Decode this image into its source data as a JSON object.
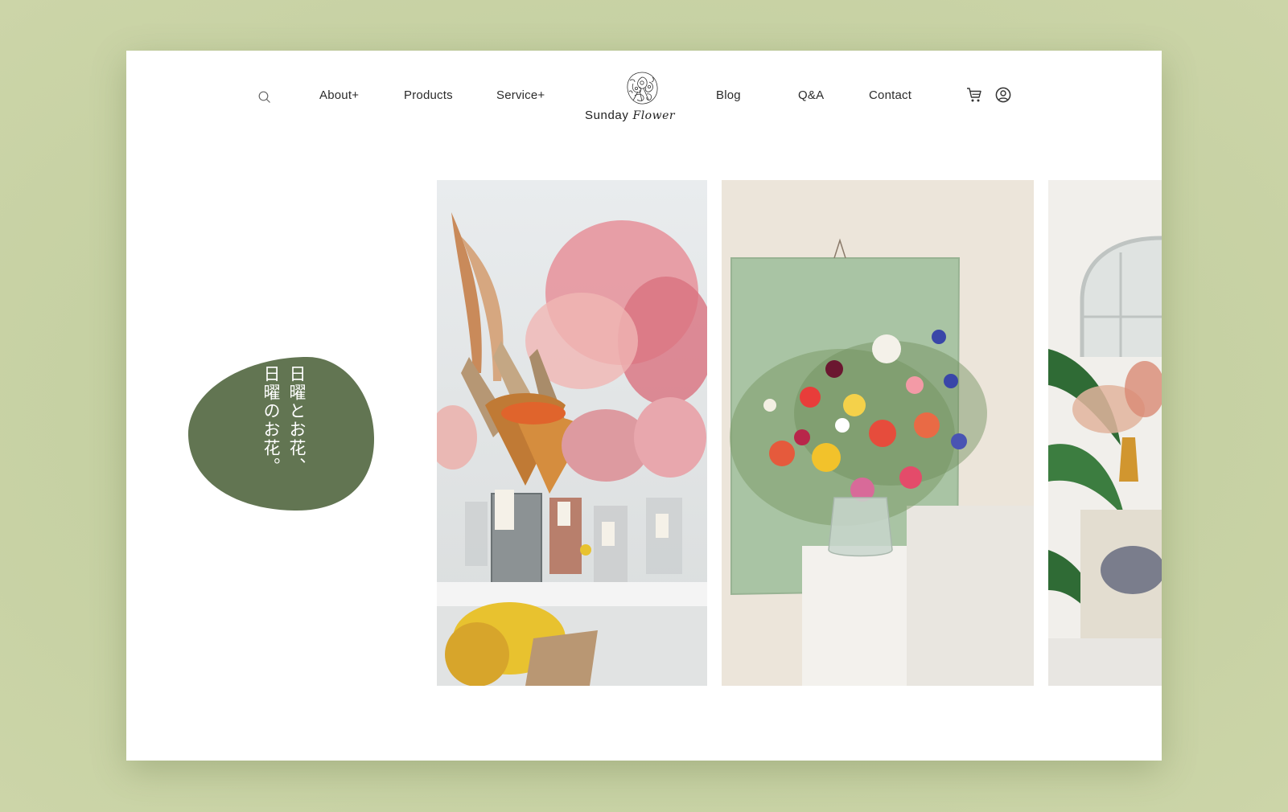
{
  "header": {
    "nav_left": [
      "About+",
      "Products",
      "Service+"
    ],
    "nav_right": [
      "Blog",
      "Q&A",
      "Contact"
    ],
    "logo": {
      "word": "Sunday",
      "script": "Flower"
    },
    "icons": {
      "search": "search-icon",
      "cart": "cart-icon",
      "account": "user-circle-icon"
    }
  },
  "hero": {
    "tagline_lines": [
      "日曜とお花、",
      "日曜のお花。"
    ],
    "badge_color": "#627552"
  },
  "gallery": {
    "photos": [
      {
        "subject": "dried-flower-display"
      },
      {
        "subject": "fresh-flower-arrangement"
      },
      {
        "subject": "plant-filled-room"
      }
    ]
  },
  "colors": {
    "backdrop": "#c5d0a2",
    "badge": "#627552",
    "text": "#2b2b2b"
  }
}
